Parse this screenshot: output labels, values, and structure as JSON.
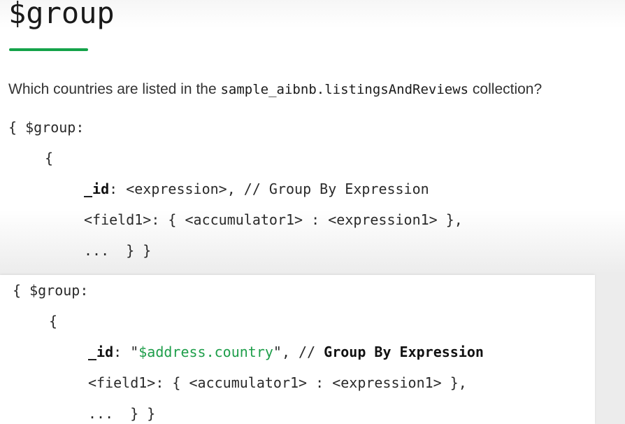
{
  "title": "$group",
  "accent_color": "#14a34a",
  "question": {
    "prefix": "Which countries are listed in the ",
    "collection": "sample_aibnb.listingsAndReviews",
    "suffix": " collection?"
  },
  "template_block": {
    "line1": "{ $group:",
    "line2": "{",
    "line3_key": "_id",
    "line3_rest": ": <expression>, // Group By Expression",
    "line4": "<field1>: { <accumulator1> : <expression1> },",
    "line5": "...  } }"
  },
  "example_block": {
    "line1": "{ $group:",
    "line2": "{",
    "line3_key": "_id",
    "line3_colon": ": \"",
    "line3_value": "$address.country",
    "line3_mid": "\", // ",
    "line3_comment": "Group By Expression",
    "line4": "<field1>: { <accumulator1> : <expression1> },",
    "line5": "...  } }"
  }
}
